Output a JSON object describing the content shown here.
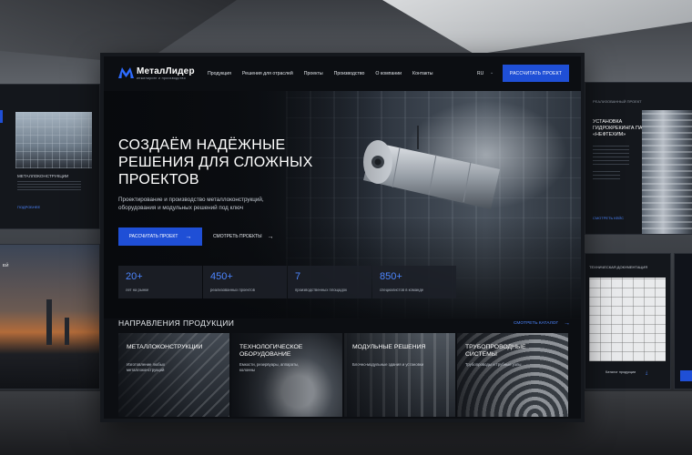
{
  "brand": {
    "name": "МеталЛидер",
    "tagline": "инжиниринг и производство"
  },
  "nav": {
    "items": [
      "Продукция",
      "Решения для отраслей",
      "Проекты",
      "Производство",
      "О компании",
      "Контакты"
    ],
    "lang": "RU",
    "cta": "РАССЧИТАТЬ ПРОЕКТ"
  },
  "hero": {
    "title_lines": [
      "СОЗДАЁМ НАДЁЖНЫЕ",
      "РЕШЕНИЯ ДЛЯ СЛОЖНЫХ",
      "ПРОЕКТОВ"
    ],
    "subtitle_lines": [
      "Проектирование и производство металлоконструкций,",
      "оборудования и модульных решений под ключ"
    ],
    "btn_primary": "РАССЧИТАТЬ ПРОЕКТ",
    "btn_secondary": "СМОТРЕТЬ ПРОЕКТЫ"
  },
  "stats": [
    {
      "value": "20+",
      "label": "лет на рынке"
    },
    {
      "value": "450+",
      "label": "реализованных проектов"
    },
    {
      "value": "7",
      "label": "производственных площадок"
    },
    {
      "value": "850+",
      "label": "специалистов в команде"
    }
  ],
  "directions": {
    "title": "НАПРАВЛЕНИЯ ПРОДУКЦИИ",
    "link": "СМОТРЕТЬ КАТАЛОГ",
    "cards": [
      {
        "title": "МЕТАЛЛОКОНСТРУКЦИИ",
        "desc": "Изготовление любых металлоконструкций"
      },
      {
        "title": "ТЕХНОЛОГИЧЕСКОЕ ОБОРУДОВАНИЕ",
        "desc": "Емкости, резервуары, аппараты, колонны"
      },
      {
        "title": "МОДУЛЬНЫЕ РЕШЕНИЯ",
        "desc": "Блочно-модульные здания и установки"
      },
      {
        "title": "ТРУБОПРОВОДНЫЕ СИСТЕМЫ",
        "desc": "Трубопроводы и трубные узлы"
      }
    ]
  },
  "side": {
    "left_top": {
      "title": "МЕТАЛЛОКОНСТРУКЦИИ",
      "link": "ПОДРОБНЕЕ"
    },
    "left_bottom": {
      "title": "РЕШЕНИЯ ДЛЯ ОТРАСЛЕЙ"
    },
    "right_top": {
      "kicker": "РЕАЛИЗОВАННЫЙ ПРОЕКТ",
      "title": "УСТАНОВКА ГИДРОКРЕКИНГА ПАО «НЕФТЕХИМ»",
      "link": "СМОТРЕТЬ КЕЙС"
    },
    "right_bottom": {
      "title": "ТЕХНИЧЕСКАЯ ДОКУМЕНТАЦИЯ",
      "caption": "Каталог продукции"
    }
  },
  "colors": {
    "accent": "#1f4fd6",
    "accent_text": "#4d86ff",
    "panel": "#0c0e12"
  }
}
